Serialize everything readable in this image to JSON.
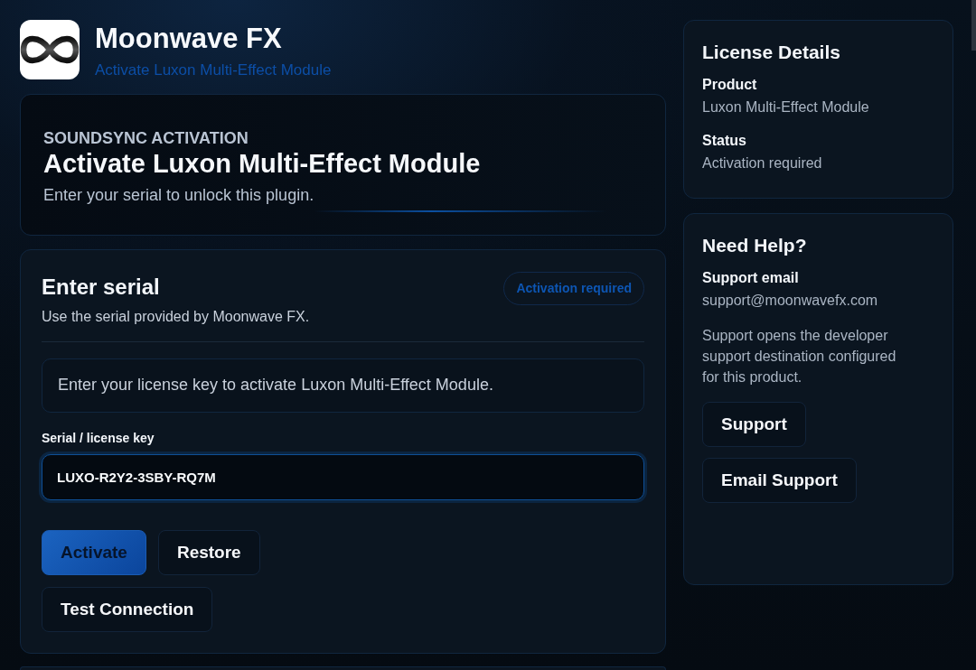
{
  "header": {
    "brand": "Moonwave FX",
    "subtitle": "Activate Luxon Multi-Effect Module"
  },
  "hero": {
    "eyebrow": "SOUNDSYNC ACTIVATION",
    "title": "Activate Luxon Multi-Effect Module",
    "text": "Enter your serial to unlock this plugin."
  },
  "serial_card": {
    "title": "Enter serial",
    "subtitle": "Use the serial provided by Moonwave FX.",
    "badge": "Activation required",
    "notice": "Enter your license key to activate Luxon Multi-Effect Module.",
    "field": {
      "label": "Serial / license key",
      "value": "LUXO-R2Y2-3SBY-RQ7M",
      "focused": true
    },
    "buttons": [
      {
        "label": "Activate",
        "kind": "primary"
      },
      {
        "label": "Restore",
        "kind": "secondary"
      },
      {
        "label": "Test Connection",
        "kind": "secondary"
      }
    ]
  },
  "license_details": {
    "title": "License Details",
    "fields": [
      {
        "label": "Product",
        "value": "Luxon Multi-Effect Module"
      },
      {
        "label": "Status",
        "value": "Activation required"
      }
    ]
  },
  "help": {
    "title": "Need Help?",
    "fields": [
      {
        "label": "Support email",
        "value": "support@moonwavefx.com"
      }
    ],
    "note": "Support opens the developer support destination configured for this product.",
    "buttons": [
      {
        "label": "Support"
      },
      {
        "label": "Email Support"
      }
    ]
  }
}
